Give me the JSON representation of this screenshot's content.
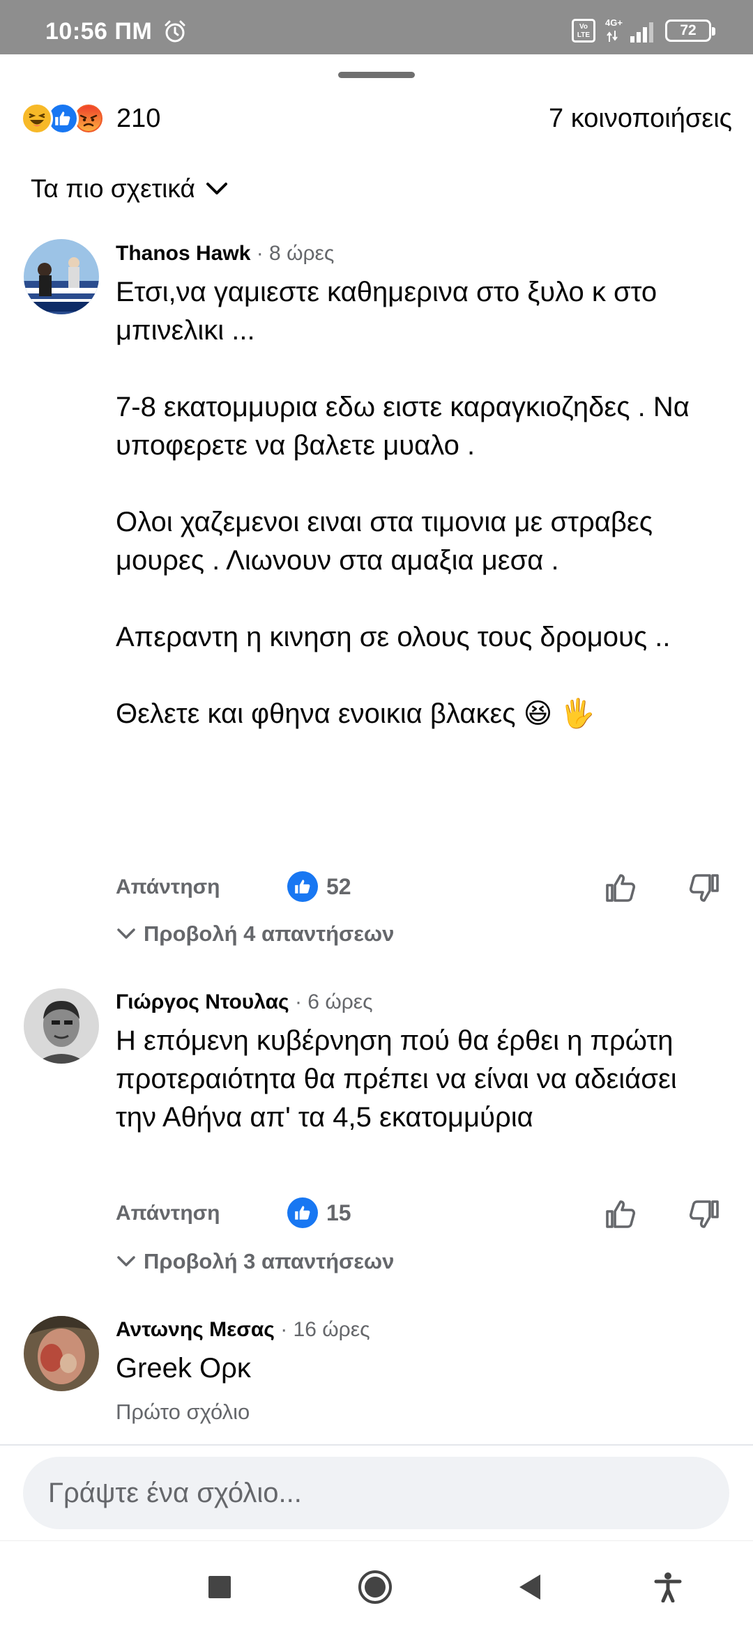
{
  "status_bar": {
    "time": "10:56 ΠΜ",
    "network": "4G+",
    "volte": "Vo LTE",
    "battery": "72"
  },
  "reactions": {
    "count": "210",
    "shares": "7 κοινοποιήσεις",
    "types": [
      "haha",
      "like",
      "angry"
    ]
  },
  "sort": {
    "label": "Τα πιο σχετικά"
  },
  "comments": [
    {
      "author": "Thanos Hawk",
      "time": "· 8 ώρες",
      "paragraphs": [
        "Ετσι,να γαμιεστε καθημερινα στο ξυλο κ στο μπινελικι ...",
        "",
        "7-8 εκατομμυρια εδω ειστε καραγκιοζηδες . Να υποφερετε να βαλετε μυαλο .",
        "",
        "Ολοι χαζεμενοι ειναι στα τιμονια με στραβες μουρες . Λιωνουν στα αμαξια μεσα .",
        "",
        "Απεραντη η κινηση σε ολους τους δρομους ..",
        "",
        "Θελετε και φθηνα ενοικια βλακες 😆 🖐️"
      ],
      "reply_label": "Απάντηση",
      "likes": "52",
      "view_replies": "Προβολή 4 απαντήσεων"
    },
    {
      "author": "Γιώργος Ντουλας",
      "time": "· 6 ώρες",
      "paragraphs": [
        "Η επόμενη κυβέρνηση πού θα έρθει η πρώτη προτεραιότητα θα πρέπει να είναι να αδειάσει την Αθήνα απ' τα 4,5 εκατομμύρια"
      ],
      "reply_label": "Απάντηση",
      "likes": "15",
      "view_replies": "Προβολή 3 απαντήσεων"
    },
    {
      "author": "Αντωνης Μεσας",
      "time": "· 16 ώρες",
      "paragraphs": [
        "Greek Ορκ"
      ],
      "first_comment_label": "Πρώτο σχόλιο"
    }
  ],
  "composer": {
    "placeholder": "Γράψτε ένα σχόλιο..."
  },
  "colors": {
    "accent": "#1877f2",
    "secondary_text": "#65676b",
    "status_bar": "#8e8e8e"
  }
}
